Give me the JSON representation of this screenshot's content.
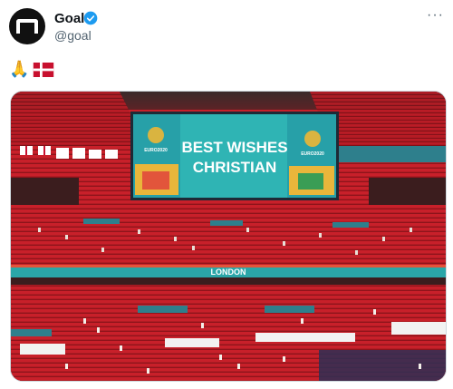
{
  "account": {
    "name": "Goal",
    "handle": "@goal",
    "avatar_icon": "goal-logo-icon",
    "verified_icon": "verified-badge-icon"
  },
  "more_label": "···",
  "tweet": {
    "emoji_text": "🙏",
    "flag_icon": "denmark-flag-icon"
  },
  "image": {
    "screen_line1": "BEST WISHES",
    "screen_line2": "CHRISTIAN",
    "banner_text": "LONDON",
    "euro_logo_text": "EURO2020"
  },
  "colors": {
    "seat_red": "#c8202a",
    "screen_teal": "#2fb4b4",
    "verified_blue": "#1d9bf0"
  }
}
